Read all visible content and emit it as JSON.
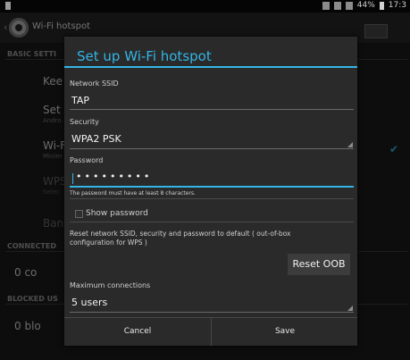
{
  "status_bar": {
    "battery": "44%",
    "time": "17:3"
  },
  "action_bar": {
    "title": "Wi-Fi hotspot"
  },
  "background": {
    "section_basic": "BASIC SETTI",
    "item_keep": "Kee",
    "item_set": "Set u",
    "item_set_sub": "Andro",
    "item_wifi": "Wi-F",
    "item_wifi_sub": "Minim",
    "item_wps": "WPS",
    "item_wps_sub": "Selec",
    "item_ban": "Ban",
    "section_connected": "CONNECTED",
    "connected_count": "0 co",
    "section_blocked": "BLOCKED US",
    "blocked_count": "0 blo"
  },
  "dialog": {
    "title": "Set up Wi-Fi hotspot",
    "ssid_label": "Network SSID",
    "ssid_value": "TAP",
    "security_label": "Security",
    "security_value": "WPA2 PSK",
    "password_label": "Password",
    "password_value": "•••••••••",
    "password_hint": "The password must have at least 8 characters.",
    "show_password_label": "Show password",
    "reset_desc": "Reset network SSID, security and password to default ( out-of-box configuration for WPS )",
    "reset_button": "Reset OOB",
    "max_conn_label": "Maximum connections",
    "max_conn_value": "5 users",
    "cancel_button": "Cancel",
    "save_button": "Save"
  },
  "colors": {
    "accent": "#33b5e5",
    "dialog_bg": "#2a2a2a"
  },
  "icons": [
    "settings-gear-icon",
    "checkmark-icon",
    "wifi-icon",
    "battery-icon"
  ]
}
